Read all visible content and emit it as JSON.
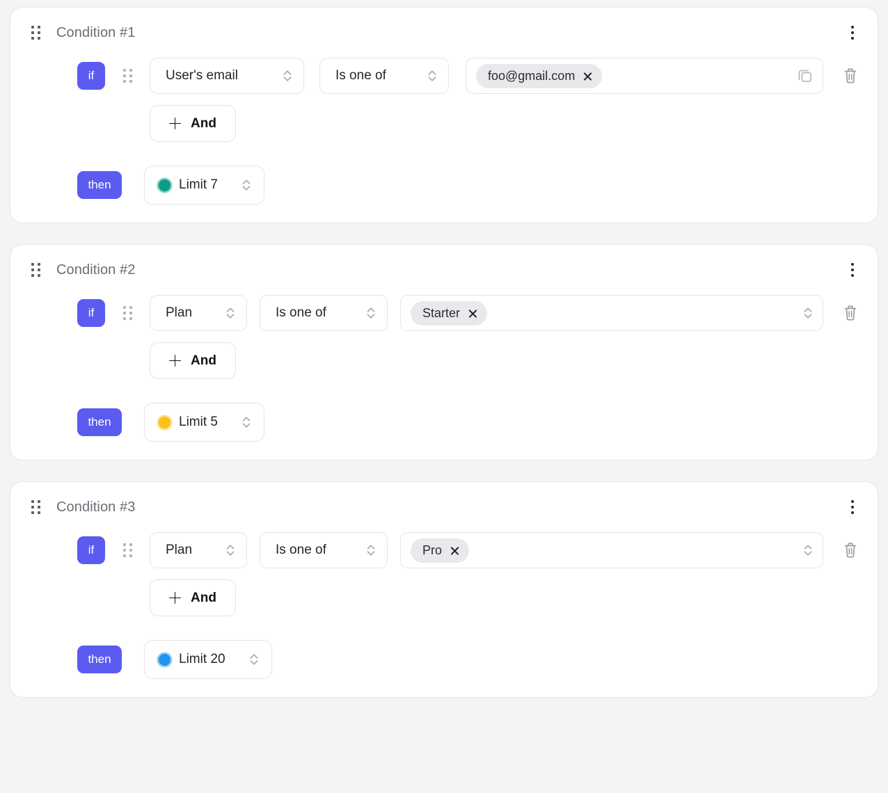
{
  "theme": {
    "page_background": "#f4f4f5",
    "card_background": "#ffffff",
    "card_border": "#e7e7ea",
    "badge_color": "#5b5bf0",
    "chip_background": "#e9e9ed",
    "title_color": "#6c6c76"
  },
  "icons": {
    "drag_handle": "drag-handle-icon",
    "kebab": "more-vertical-icon",
    "chevron_updown": "chevron-up-down-icon",
    "copy": "copy-icon",
    "trash": "trash-icon",
    "close": "close-icon",
    "plus": "plus-icon"
  },
  "conditions": [
    {
      "title": "Condition #1",
      "if_badge": "if",
      "then_badge": "then",
      "and_label": "And",
      "attribute": "User's email",
      "operator": "Is one of",
      "values": [
        {
          "label": "foo@gmail.com"
        }
      ],
      "value_field_trailing_icon": "copy-icon",
      "result": {
        "label": "Limit 7",
        "dot_color": "#0e9b87",
        "ring_color": "#7fd3c6"
      }
    },
    {
      "title": "Condition #2",
      "if_badge": "if",
      "then_badge": "then",
      "and_label": "And",
      "attribute": "Plan",
      "operator": "Is one of",
      "values": [
        {
          "label": "Starter"
        }
      ],
      "value_field_trailing_icon": "chevron-up-down-icon",
      "result": {
        "label": "Limit 5",
        "dot_color": "#fcc017",
        "ring_color": "#fde08a"
      }
    },
    {
      "title": "Condition #3",
      "if_badge": "if",
      "then_badge": "then",
      "and_label": "And",
      "attribute": "Plan",
      "operator": "Is one of",
      "values": [
        {
          "label": "Pro"
        }
      ],
      "value_field_trailing_icon": "chevron-up-down-icon",
      "result": {
        "label": "Limit 20",
        "dot_color": "#1f95f0",
        "ring_color": "#95cdf7"
      }
    }
  ]
}
